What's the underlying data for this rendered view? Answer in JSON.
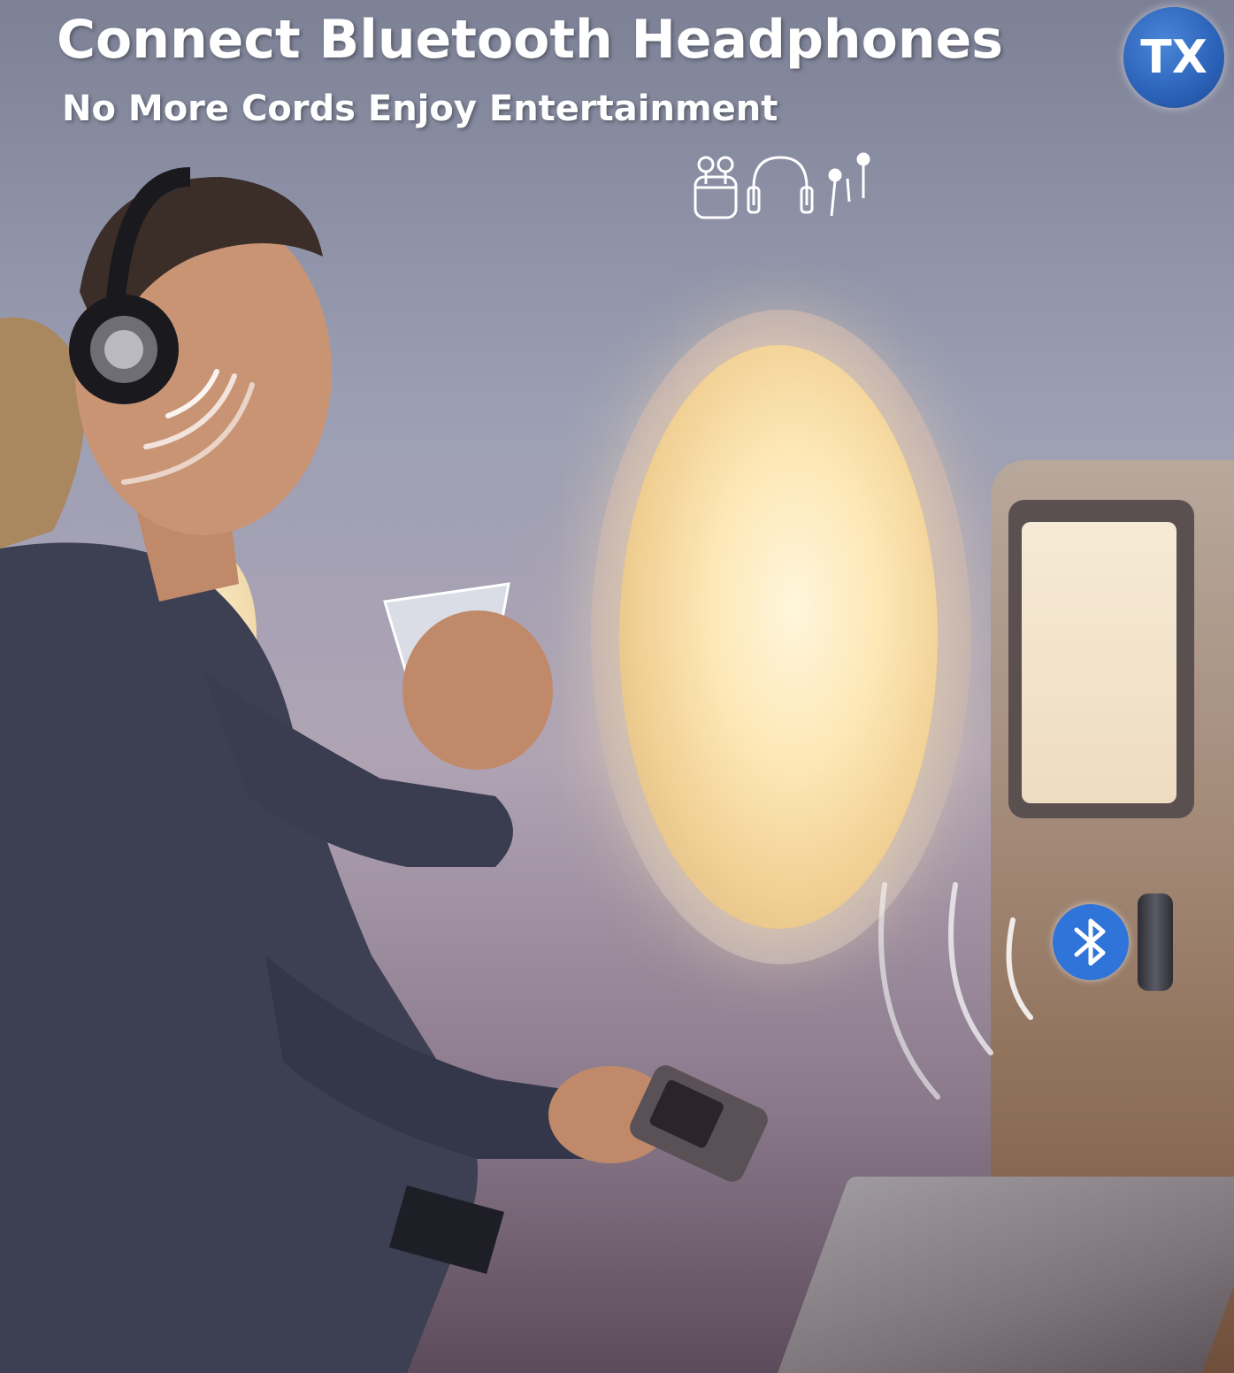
{
  "header": {
    "title": "Connect Bluetooth Headphones",
    "subtitle": "No More Cords Enjoy Entertainment"
  },
  "badge": {
    "label": "TX",
    "color": "#2b62b8"
  },
  "headphone_icons": [
    "earbuds-case-icon",
    "over-ear-headphones-icon",
    "wired-earphones-icon"
  ],
  "bluetooth": {
    "icon": "bluetooth-icon",
    "color": "#2f74d8"
  }
}
